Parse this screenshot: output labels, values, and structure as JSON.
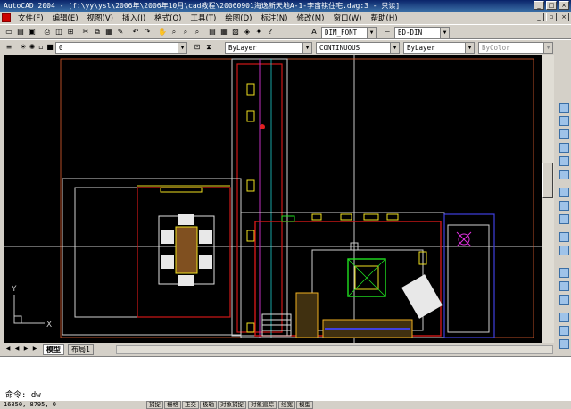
{
  "window": {
    "title": "AutoCAD 2004 - [f:\\yy\\ysl\\2006年\\2006年10月\\cad教程\\20060901海逸新天地A-1-李宙祺住宅.dwg:3 - 只读]"
  },
  "menu": {
    "items": [
      "文件(F)",
      "编辑(E)",
      "视图(V)",
      "插入(I)",
      "格式(O)",
      "工具(T)",
      "绘图(D)",
      "标注(N)",
      "修改(M)",
      "窗口(W)",
      "帮助(H)"
    ]
  },
  "toolbar_style": {
    "text_style": "DIM_FONT",
    "dim_style": "BD-DIN"
  },
  "layer_toolbar": {
    "layer_value": "0",
    "color": "ByLayer",
    "linetype": "CONTINUOUS",
    "lineweight": "ByLayer",
    "plotstyle": "ByColor"
  },
  "ucs": {
    "x_label": "X",
    "y_label": "Y"
  },
  "tabs": [
    {
      "label": "模型",
      "active": true
    },
    {
      "label": "布局1",
      "active": false
    }
  ],
  "command": {
    "prompt": "命令:",
    "input": "dw"
  },
  "status": {
    "coords": "16850, 8795, 0",
    "buttons": [
      "捕捉",
      "栅格",
      "正交",
      "极轴",
      "对象捕捉",
      "对象追踪",
      "线宽",
      "模型"
    ]
  },
  "colors": {
    "canvas": "#000000",
    "titlebar": "#0a246a",
    "wall_red": "#d01818",
    "wall_white": "#e0e0e0",
    "yellow": "#f0e020",
    "green": "#20e020",
    "magenta": "#e030e0",
    "cyan": "#20d0d0"
  }
}
